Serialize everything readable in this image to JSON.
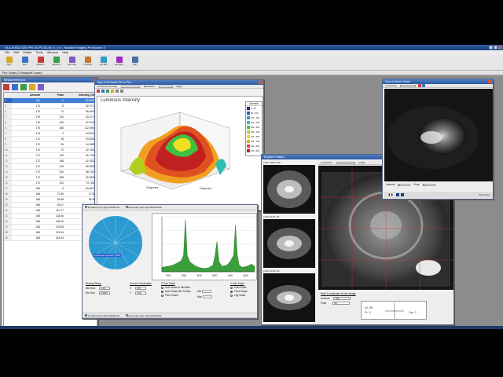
{
  "app": {
    "title": "DLA-00015-025-PHI-00-P3-03-5b_0_o.ti - Radiant Imaging ProSource 2",
    "menu": [
      "File",
      "Edit",
      "Model",
      "Tools",
      "Window",
      "Help"
    ],
    "toolbar": [
      {
        "label": "Open",
        "icon": "open-icon",
        "color": "#d9a72a"
      },
      {
        "label": "Save",
        "icon": "save-icon",
        "color": "#3d6fc4"
      },
      {
        "label": "Measure",
        "icon": "measure-icon",
        "color": "#c43d3d"
      },
      {
        "label": "Alignment",
        "icon": "alignment-icon",
        "color": "#3a9e4a"
      },
      {
        "label": "New Field",
        "icon": "new-field-icon",
        "color": "#7d5ac4"
      },
      {
        "label": "Far Field",
        "icon": "far-field-icon",
        "color": "#c47a2a"
      },
      {
        "label": "Gen IES",
        "icon": "gen-ies-icon",
        "color": "#2a9ec4"
      },
      {
        "label": "Gen Rays",
        "icon": "gen-rays-icon",
        "color": "#9e2ac4"
      },
      {
        "label": "Help",
        "icon": "help-icon",
        "color": "#4a6fa0"
      }
    ],
    "info_bar": "Plot: Scaled (1 Measured Lumen)"
  },
  "measurement_list": {
    "title": "Measurement List",
    "columns": [
      "",
      "Azimuth",
      "Polar",
      "Intensity (Cd)"
    ],
    "rows": [
      [
        "1",
        "180",
        "0",
        "83.5083"
      ],
      [
        "2",
        "176",
        "8",
        "82.7072"
      ],
      [
        "3",
        "176",
        "72",
        "66.4462"
      ],
      [
        "4",
        "176",
        "144",
        "63.1279"
      ],
      [
        "5",
        "176",
        "216",
        "67.0048"
      ],
      [
        "6",
        "176",
        "288",
        "112.4954"
      ],
      [
        "7",
        "176",
        "0",
        "64.6342"
      ],
      [
        "8",
        "172",
        "48",
        "53.6265"
      ],
      [
        "9",
        "172",
        "96",
        "54.3585"
      ],
      [
        "10",
        "172",
        "72",
        "32.7483"
      ],
      [
        "11",
        "172",
        "120",
        "26.7189"
      ],
      [
        "12",
        "172",
        "168",
        "42.3252"
      ],
      [
        "13",
        "172",
        "216",
        "55.3845"
      ],
      [
        "14",
        "172",
        "240",
        "58.7183"
      ],
      [
        "15",
        "172",
        "288",
        "52.4826"
      ],
      [
        "16",
        "172",
        "324",
        "74.7182"
      ],
      [
        "17",
        "168",
        "0",
        "84.6437"
      ],
      [
        "18",
        "168",
        "27.69",
        "27.68"
      ],
      [
        "19",
        "168",
        "55.38",
        "55.38"
      ],
      [
        "20",
        "168",
        "83.07",
        "83.07"
      ],
      [
        "21",
        "168",
        "110.77",
        "110.77"
      ],
      [
        "22",
        "168",
        "138.46",
        "138.46"
      ],
      [
        "23",
        "168",
        "166.15",
        "166.15"
      ],
      [
        "24",
        "168",
        "193.85",
        "193.85"
      ],
      [
        "25",
        "168",
        "221.54",
        "221.54"
      ],
      [
        "26",
        "168",
        "249.23",
        "249.23"
      ]
    ]
  },
  "far_field": {
    "title": "Near Field Radar 3D for Plot",
    "strip": [
      "Luminous Intensity",
      "Resolution",
      "Apply"
    ],
    "plot_title": "Luminous Intensity",
    "axis_label_left": "Degrees",
    "axis_label_right": "Degrees",
    "legend_title": "Candela",
    "legend_colors": [
      "#2020a0",
      "#2a5ad0",
      "#2a9ad0",
      "#2ac0b0",
      "#40c040",
      "#b0d020",
      "#f0e020",
      "#f0a020",
      "#e05020",
      "#c02020"
    ],
    "legend_values": [
      "0 - 50",
      "50 - 100",
      "100 - 150",
      "150 - 200",
      "200 - 250",
      "250 - 300",
      "300 - 350",
      "350 - 400",
      "400 - 450",
      "450 - 500"
    ]
  },
  "spectrum": {
    "radio_forward": "Forward (LD) Light Distribution",
    "radio_reversed": "Reversed (LD) Light Distribution",
    "binning_title": "Binning Setup",
    "bin_start_label": "Min Bins",
    "bin_start_value": "1.00",
    "bin_size_label": "Bin Size",
    "bin_size_value": "4.0000",
    "cursor_title": "Cursor Coordinates",
    "cursor_x_label": "X",
    "cursor_x_value": "467",
    "cursor_y_label": "Y",
    "cursor_y_value": "0.00",
    "x_scale_title": "X Axis Scale",
    "x_opts": [
      "Auto Scale to Min/Max",
      "Auto Scale Min To Max",
      "Fixed Scale"
    ],
    "x_min_label": "Min",
    "x_max_label": "Max",
    "y_scale_title": "Y Axis Scale",
    "y_opts": [
      "Auto Scale",
      "Fixed Scale",
      "Log Scale"
    ],
    "x_ticks": [
      "200",
      "250",
      "300",
      "350",
      "400",
      "450"
    ]
  },
  "spectrum_chart": {
    "type": "area",
    "x": [
      180,
      200,
      215,
      230,
      242,
      250,
      256,
      262,
      270,
      280,
      290,
      300,
      315,
      330,
      345,
      352,
      358,
      365,
      375,
      390,
      400,
      412,
      418,
      424,
      430,
      440,
      455,
      470,
      480
    ],
    "y": [
      0.08,
      0.1,
      0.12,
      0.16,
      0.2,
      0.3,
      0.95,
      0.3,
      0.18,
      0.14,
      0.1,
      0.08,
      0.06,
      0.07,
      0.12,
      0.3,
      0.55,
      0.18,
      0.1,
      0.12,
      0.18,
      0.3,
      0.85,
      0.3,
      0.12,
      0.08,
      0.1,
      0.14,
      0.1
    ],
    "xlim": [
      180,
      480
    ],
    "ylim": [
      0,
      1
    ],
    "color": "#3a9e3a"
  },
  "polar_chart": {
    "type": "heatmap",
    "label": "Luminous Intensity Chart",
    "rings": [
      "#c02020",
      "#e05020",
      "#f0a020",
      "#f0e020",
      "#b0d020",
      "#40c040",
      "#2ac0b0",
      "#2a9ad0"
    ]
  },
  "engineer_images": {
    "title": "Engineer Images",
    "strip": [
      "Luminance",
      "Image"
    ],
    "thumb_labels": [
      "LS1C 180 PL 90",
      "LS1C 90 PL 45",
      "LS1C 90 PL 30"
    ],
    "pixel_title": "Pixel Coordinates for the Image",
    "azimuth_label": "Azimuth",
    "azimuth_value": "180",
    "polar_label": "Polar",
    "polar_value": "90",
    "compass": [
      "AZ 180",
      "PL -3",
      "Gan -2"
    ]
  },
  "source_model": {
    "title": "Source Model Viewer",
    "strip": [
      "Luminance"
    ],
    "azimuth_label": "Azimuth",
    "polar_label": "Polar",
    "azimuth_value": "0",
    "polar_value": "0",
    "footer": "Zoom Out"
  }
}
